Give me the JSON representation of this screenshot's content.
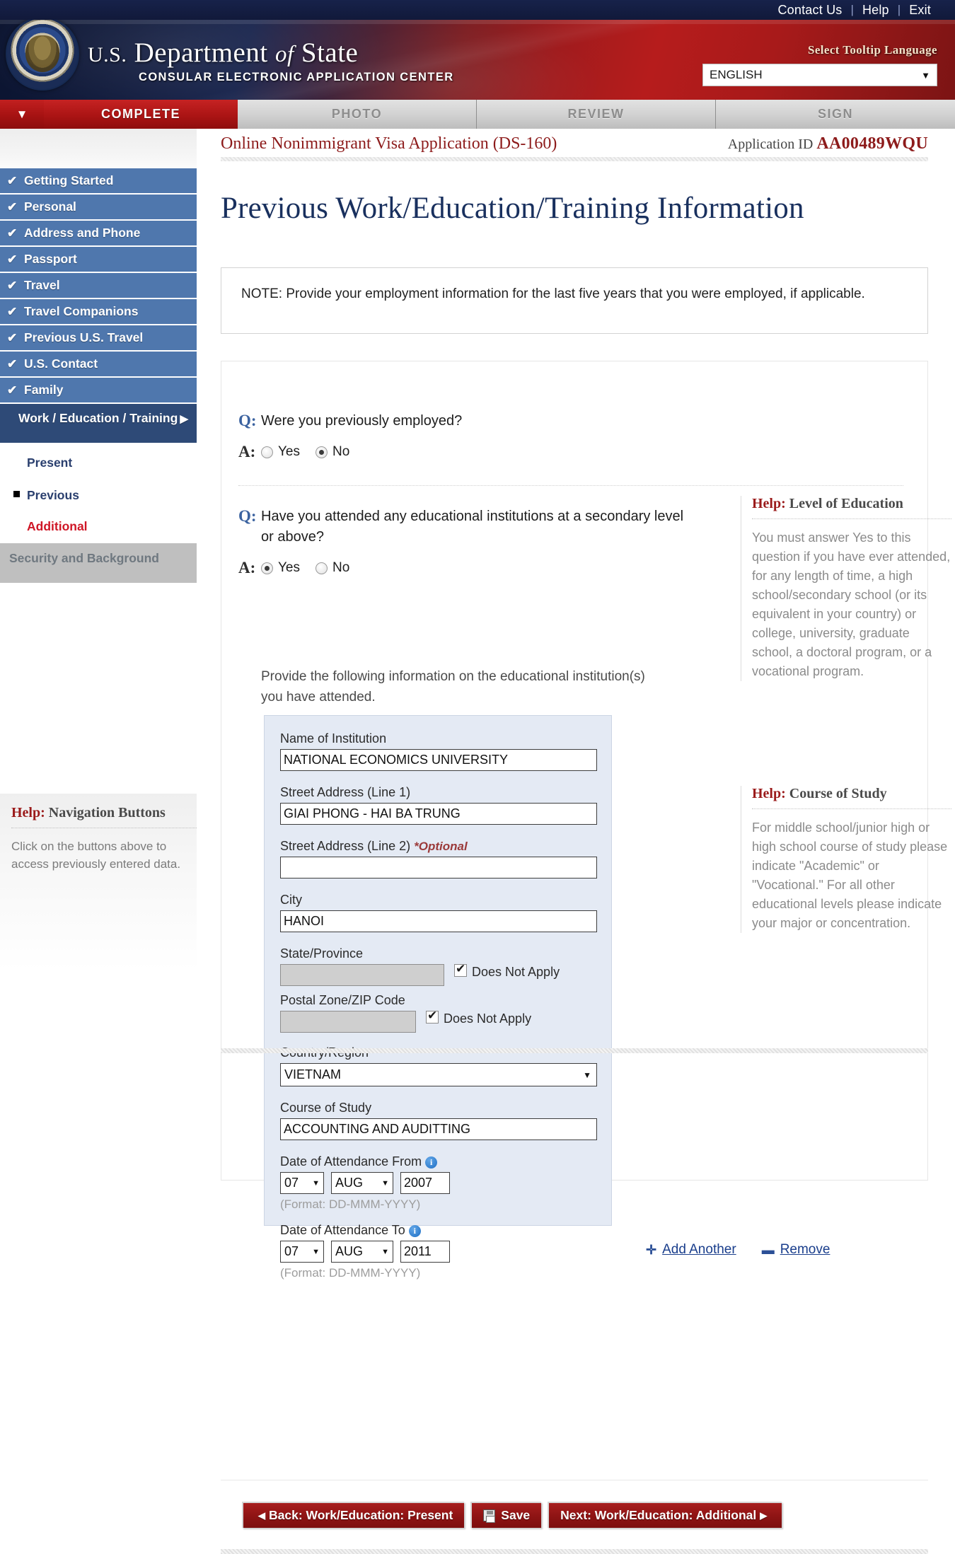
{
  "utility": {
    "links": [
      "Contact Us",
      "Help",
      "Exit"
    ],
    "separator": "|"
  },
  "banner": {
    "title_us": "U.S.",
    "title_department": "Department",
    "title_of": "of",
    "title_state": "State",
    "subtitle": "CONSULAR ELECTRONIC APPLICATION CENTER",
    "tooltip_language_label": "Select Tooltip Language",
    "tooltip_language_value": "ENGLISH",
    "dropdown_arrow": "▼"
  },
  "steps": {
    "arrow": "▼",
    "items": [
      "COMPLETE",
      "PHOTO",
      "REVIEW",
      "SIGN"
    ],
    "active": "COMPLETE"
  },
  "sidebar": {
    "items": [
      {
        "label": "Getting Started",
        "check": "✔"
      },
      {
        "label": "Personal",
        "check": "✔"
      },
      {
        "label": "Address and Phone",
        "check": "✔"
      },
      {
        "label": "Passport",
        "check": "✔"
      },
      {
        "label": "Travel",
        "check": "✔"
      },
      {
        "label": "Travel Companions",
        "check": "✔"
      },
      {
        "label": "Previous U.S. Travel",
        "check": "✔"
      },
      {
        "label": "U.S. Contact",
        "check": "✔"
      },
      {
        "label": "Family",
        "check": "✔"
      }
    ],
    "current": {
      "label": "Work / Education / Training",
      "caret": "▶"
    },
    "sub_items": [
      {
        "label": "Present"
      },
      {
        "label": "Previous"
      },
      {
        "label": "Additional"
      },
      {
        "label": "Security and Background"
      }
    ],
    "help_nav": {
      "title_word": "Help:",
      "title_rest": " Navigation Buttons",
      "body": "Click on the buttons above to access previously entered data."
    }
  },
  "doc": {
    "form_name": "Online Nonimmigrant Visa Application (DS-160)",
    "app_id_label": "Application ID",
    "app_id_value": "AA00489WQU",
    "page_title": "Previous Work/Education/Training Information",
    "note": "NOTE: Provide your employment information for the last five years that you were employed, if applicable."
  },
  "questions": {
    "q_mark": "Q:",
    "a_mark": "A:",
    "employed": {
      "question": "Were you previously employed?",
      "options": [
        "Yes",
        "No"
      ],
      "selected": "No"
    },
    "education": {
      "question": "Have you attended any educational institutions at a secondary level or above?",
      "options": [
        "Yes",
        "No"
      ],
      "selected": "Yes",
      "lead_text": "Provide the following information on the educational institution(s) you have attended."
    }
  },
  "education_form": {
    "name_of_institution": {
      "label": "Name of Institution",
      "value": "NATIONAL ECONOMICS UNIVERSITY"
    },
    "street1": {
      "label": "Street Address (Line 1)",
      "value": "GIAI PHONG - HAI BA TRUNG"
    },
    "street2": {
      "label": "Street Address (Line 2)",
      "optional_tag": "*Optional",
      "value": ""
    },
    "city": {
      "label": "City",
      "value": "HANOI"
    },
    "state_province": {
      "label": "State/Province",
      "value": "",
      "checkbox_label": "Does Not Apply",
      "checked": true
    },
    "postal": {
      "label": "Postal Zone/ZIP Code",
      "value": "",
      "checkbox_label": "Does Not Apply",
      "checked": true
    },
    "country": {
      "label": "Country/Region",
      "value": "VIETNAM",
      "arrow": "▼"
    },
    "course_of_study": {
      "label": "Course of Study",
      "value": "ACCOUNTING AND AUDITTING"
    },
    "date_from": {
      "label": "Date of Attendance From",
      "day": "07",
      "month": "AUG",
      "year": "2007",
      "format_hint": "(Format: DD-MMM-YYYY)",
      "info": "i"
    },
    "date_to": {
      "label": "Date of Attendance To",
      "day": "07",
      "month": "AUG",
      "year": "2011",
      "format_hint": "(Format: DD-MMM-YYYY)",
      "info": "i"
    },
    "add_another": {
      "sign": "✛",
      "label": "Add Another"
    },
    "remove": {
      "sign": "▬",
      "label": "Remove"
    }
  },
  "help_panels": [
    {
      "title_word": "Help:",
      "title_rest": " Level of Education",
      "body": "You must answer Yes to this question if you have ever attended, for any length of time, a high school/secondary school (or its equivalent in your country) or college, university, graduate school, a doctoral program, or a vocational program."
    },
    {
      "title_word": "Help:",
      "title_rest": " Course of Study",
      "body": "For middle school/junior high or high school course of study please indicate \"Academic\" or \"Vocational.\" For all other educational levels please indicate your major or concentration."
    }
  ],
  "buttons": {
    "back": {
      "arrow": "◀",
      "label": "Back: Work/Education: Present"
    },
    "save": {
      "label": "Save"
    },
    "next": {
      "label": "Next: Work/Education: Additional",
      "arrow": "▶"
    }
  },
  "colors": {
    "brand_red": "#8d1b1b",
    "nav_blue": "#4f77ad",
    "nav_blue_active": "#2e4a77",
    "title_navy": "#19305e",
    "alert_red": "#cf1626"
  }
}
